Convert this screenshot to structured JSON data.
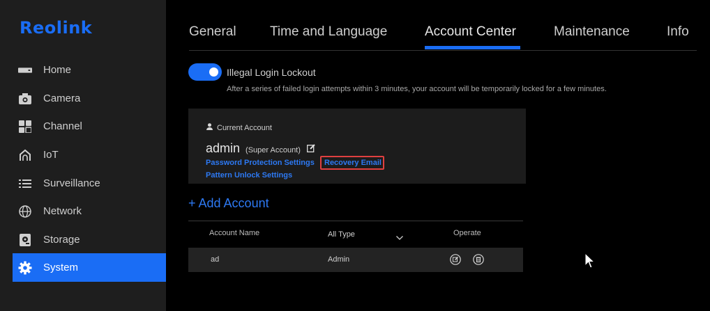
{
  "brand": {
    "logo_text": "Reolink",
    "accent_color": "#1a6df5"
  },
  "sidebar": {
    "items": [
      {
        "label": "Home",
        "icon": "home-icon",
        "active": false
      },
      {
        "label": "Camera",
        "icon": "camera-icon",
        "active": false
      },
      {
        "label": "Channel",
        "icon": "channel-icon",
        "active": false
      },
      {
        "label": "IoT",
        "icon": "iot-icon",
        "active": false
      },
      {
        "label": "Surveillance",
        "icon": "surveillance-icon",
        "active": false
      },
      {
        "label": "Network",
        "icon": "network-icon",
        "active": false
      },
      {
        "label": "Storage",
        "icon": "storage-icon",
        "active": false
      },
      {
        "label": "System",
        "icon": "gear-icon",
        "active": true
      }
    ]
  },
  "tabs": [
    {
      "label": "General"
    },
    {
      "label": "Time and Language"
    },
    {
      "label": "Account Center",
      "active": true
    },
    {
      "label": "Maintenance"
    },
    {
      "label": "Info"
    }
  ],
  "lockout": {
    "enabled": true,
    "title": "Illegal Login Lockout",
    "description": "After a series of failed login attempts within 3 minutes, your account will be temporarily locked for a few minutes."
  },
  "current_account": {
    "heading": "Current Account",
    "name": "admin",
    "role": "(Super Account)",
    "links": {
      "password_protection": "Password Protection Settings",
      "recovery_email": "Recovery Email",
      "pattern_unlock": "Pattern Unlock Settings"
    }
  },
  "add_account_label": "+ Add Account",
  "accounts_table": {
    "columns": {
      "name": "Account Name",
      "type": "All Type",
      "operate": "Operate"
    },
    "rows": [
      {
        "name": "ad",
        "type": "Admin"
      }
    ]
  }
}
